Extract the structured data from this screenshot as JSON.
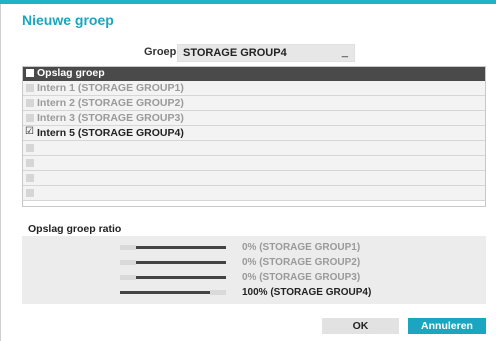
{
  "dialog": {
    "title": "Nieuwe groep"
  },
  "group": {
    "label": "Groep",
    "selected": "STORAGE GROUP4",
    "caret": "_"
  },
  "table": {
    "header": "Opslag groep",
    "rows": [
      {
        "label": "Intern 1 (STORAGE GROUP1)",
        "checked": false,
        "active": false
      },
      {
        "label": "Intern 2 (STORAGE GROUP2)",
        "checked": false,
        "active": false
      },
      {
        "label": "Intern 3 (STORAGE GROUP3)",
        "checked": false,
        "active": false
      },
      {
        "label": "Intern 5 (STORAGE GROUP4)",
        "checked": true,
        "active": true
      },
      {
        "label": "",
        "checked": false,
        "active": false
      },
      {
        "label": "",
        "checked": false,
        "active": false
      },
      {
        "label": "",
        "checked": false,
        "active": false
      },
      {
        "label": "",
        "checked": false,
        "active": false
      }
    ]
  },
  "ratio": {
    "title": "Opslag groep ratio",
    "items": [
      {
        "label": "0% (STORAGE GROUP1)",
        "fraction": 0.0,
        "active": false
      },
      {
        "label": "0% (STORAGE GROUP2)",
        "fraction": 0.0,
        "active": false
      },
      {
        "label": "0% (STORAGE GROUP3)",
        "fraction": 0.0,
        "active": false
      },
      {
        "label": "100% (STORAGE GROUP4)",
        "fraction": 1.0,
        "active": true
      }
    ]
  },
  "buttons": {
    "ok": "OK",
    "cancel": "Annuleren"
  },
  "colors": {
    "accent": "#1aa6c0",
    "header": "#4a4a4a"
  }
}
